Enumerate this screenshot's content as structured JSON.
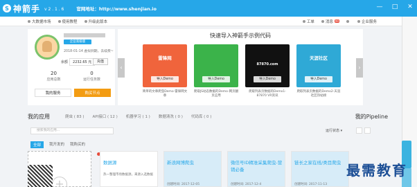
{
  "titlebar": {
    "app_name": "神箭手",
    "version": "v 2 . 1 . 6",
    "site": "官网地址：http://www.shenjian.io",
    "controls": [
      "—",
      "□",
      "✕"
    ]
  },
  "toolbar": {
    "left": [
      "大数据市场",
      "使用教程",
      "升级此版本"
    ],
    "right": [
      {
        "label": "工单"
      },
      {
        "label": "消息",
        "badge": "99"
      },
      {
        "label": ""
      },
      {
        "label": "企业服务"
      }
    ]
  },
  "user": {
    "chip": "企业高级版",
    "date": "2018-01-14 虚拟到期，去续费~",
    "balance_label": "余额",
    "balance": "2232.65 元",
    "charge": "充值",
    "stats": [
      {
        "n": "20",
        "l": "应用总数"
      },
      {
        "n": "0",
        "l": "运行任务数"
      }
    ],
    "btn1": "我的服务",
    "btn2": "购买节点"
  },
  "promo": {
    "title": "快速导入神箭手示例代码",
    "cards": [
      {
        "name": "雷锋网",
        "btn": "导入Demo",
        "desc": "简单的文章爬虫Demo-雷锋网文章"
      },
      {
        "name": "",
        "btn": "导入Demo",
        "desc": "爬取JS动态数据的Demo-网页翻页应用"
      },
      {
        "name": "87870.com",
        "btn": "导入Demo",
        "desc": "爬取列表页数据的Demo1-87870 VR资讯"
      },
      {
        "name": "天涯社区",
        "btn": "导入Demo",
        "desc": "爬取列表页数据的Demo2-天涯社区热帖榜"
      }
    ]
  },
  "apps": {
    "title": "我的应用",
    "tabs": [
      "爬虫 ( 83 )",
      "API接口 ( 12 )",
      "机器学习 ( 1 )",
      "数据清洗 ( 0 )",
      "代码库 ( 0 )"
    ],
    "pipeline": "我的Pipeline",
    "search_placeholder": "搜索我的应用...",
    "sort": "运行状态 ▾",
    "subtabs": [
      "全部",
      "我开发的",
      "我购买的"
    ],
    "items": [
      {
        "title": "数据源",
        "desc": "热一整理市场数据源，来源入选数据",
        "time": ""
      },
      {
        "title": "新浪网博爬虫",
        "desc": "",
        "time": "创建时间: 2017-12-05"
      },
      {
        "title": "微信号ID精准采集爬虫-营销必备",
        "desc": "",
        "time": "创建时间: 2017-12-4"
      },
      {
        "title": "链长之家在线/类目爬虫",
        "desc": "",
        "time": "创建时间: 2017-11-13"
      }
    ],
    "item0_tag": "1个任务"
  },
  "watermark": "最需教育"
}
